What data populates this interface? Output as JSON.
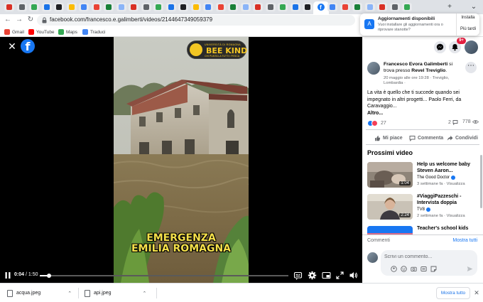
{
  "browser": {
    "url": "facebook.com/francesco.e.galimberti/videos/2144647349059379",
    "bookmarks": [
      {
        "label": "Gmail",
        "color": "#ea4335"
      },
      {
        "label": "YouTube",
        "color": "#ff0000"
      },
      {
        "label": "Maps",
        "color": "#34a853"
      },
      {
        "label": "Traduci",
        "color": "#4285f4"
      }
    ],
    "tab_count": 33,
    "active_tab_glyph": "f"
  },
  "update_popup": {
    "title": "Aggiornamenti disponibili",
    "body": "Vuoi installare gli aggiornamenti ora o riprovare stanotte?",
    "install_label": "Installa",
    "later_label": "Più tardi"
  },
  "video": {
    "overlay_logo": {
      "top_text": "UNIVERSITÀ DI ROMAGNA",
      "name": "BEE KIND",
      "sub_text": "CHI PUNTA LA TUTTI I PESCA"
    },
    "caption_lines": [
      "EMERGENZA",
      "EMILIA ROMAGNA"
    ],
    "current_time": "0:04",
    "duration": "1:50",
    "progress": 0.036
  },
  "panel": {
    "notifications_badge": "9+",
    "post": {
      "author": "Francesco Evora Galimberti",
      "location_phrase": " si trova presso ",
      "place": "Revel Treviglio",
      "meta": "20 maggio alle ore 19:28 · Treviglio, Lombardia ·",
      "text": "La vita è quello che ti succede quando sei impegnato in altri progetti... Paolo Ferri, da Caravaggio...",
      "more_label": "Altro...",
      "reaction_count": "27",
      "comment_count": "2",
      "view_count": "778"
    },
    "actions": {
      "like": "Mi piace",
      "comment": "Commenta",
      "share": "Condividi"
    },
    "next_videos_title": "Prossimi video",
    "related_videos": [
      {
        "title": "Help us welcome baby Steven Aaron...",
        "channel": "The Good Doctor",
        "meta": "3 settimane fa · Visualizza",
        "duration": "1:04"
      },
      {
        "title": "#ViaggiPazzeschi - Intervista doppia",
        "channel": "TV8",
        "meta": "2 settimane fa · Visualizza",
        "duration": "2:24"
      },
      {
        "title": "Teacher's school kids",
        "channel": "",
        "meta": "",
        "duration": ""
      }
    ],
    "comments_label": "Commenti",
    "show_all_label": "Mostra tutti",
    "comment_placeholder": "Scrivi un commento..."
  },
  "downloads": {
    "files": [
      {
        "name": "acqua.jpeg"
      },
      {
        "name": "api.jpeg"
      }
    ],
    "show_all_label": "Mostra tutto"
  },
  "colors": {
    "facebook_blue": "#1877f2",
    "caption_yellow": "#f5e04a",
    "logo_yellow": "#f3c623"
  }
}
